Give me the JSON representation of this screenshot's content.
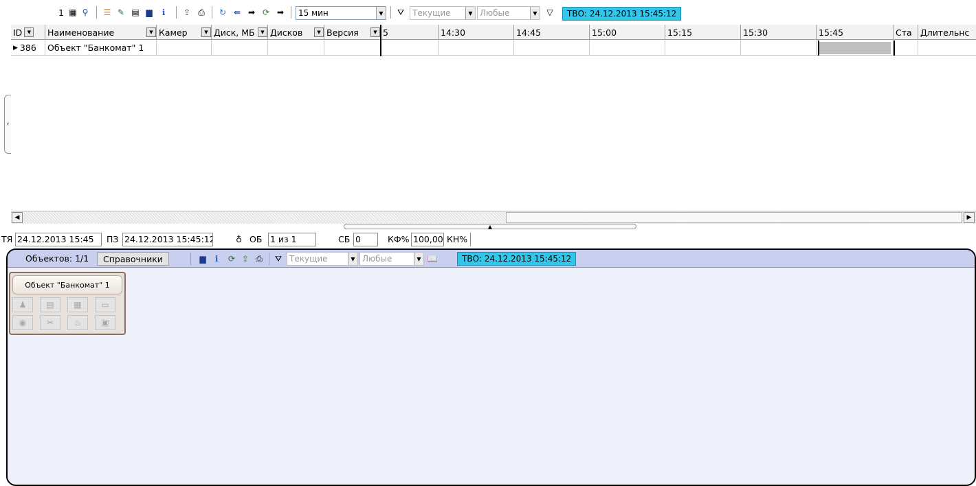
{
  "toolbar": {
    "counter": "1",
    "icons": [
      "grid-icon",
      "filter-person-icon",
      "list-orange-icon",
      "notes-icon",
      "calendar-icon",
      "color-table-icon",
      "info-icon",
      "export-icon",
      "print-icon",
      "refresh-icon",
      "back-icon",
      "forward-icon",
      "reload-icon",
      "next-icon"
    ],
    "interval": "15 мин",
    "filter_current": "Текущие",
    "filter_any": "Любые",
    "tvo": "ТВО: 24.12.2013 15:45:12"
  },
  "table": {
    "columns": {
      "id": "ID",
      "name": "Наименование",
      "cameras": "Камер",
      "disk_mb": "Диск, МБ",
      "disks": "Дисков",
      "version": "Версия",
      "t0": "5",
      "t1": "14:30",
      "t2": "14:45",
      "t3": "15:00",
      "t4": "15:15",
      "t5": "15:30",
      "t6": "15:45",
      "status": "Ста",
      "duration": "Длительнс"
    },
    "rows": [
      {
        "id": "386",
        "name": "Объект \"Банкомат\" 1"
      }
    ]
  },
  "status": {
    "tya_label": "ТЯ",
    "tya_value": "24.12.2013 15:45",
    "pz_label": "ПЗ",
    "pz_value": "24.12.2013 15:45:12",
    "ob_label": "ОБ",
    "ob_value": "1 из 1",
    "sb_label": "СБ",
    "sb_value": "0",
    "kf_label": "КФ%",
    "kf_value": "100,00",
    "kn_label": "КН%"
  },
  "panel": {
    "objects_tab": "Объектов: 1/1",
    "refs_tab": "Справочники",
    "filter_current": "Текущие",
    "filter_any": "Любые",
    "tvo": "ТВО: 24.12.2013 15:45:12",
    "card_title": "Объект \"Банкомат\" 1"
  }
}
